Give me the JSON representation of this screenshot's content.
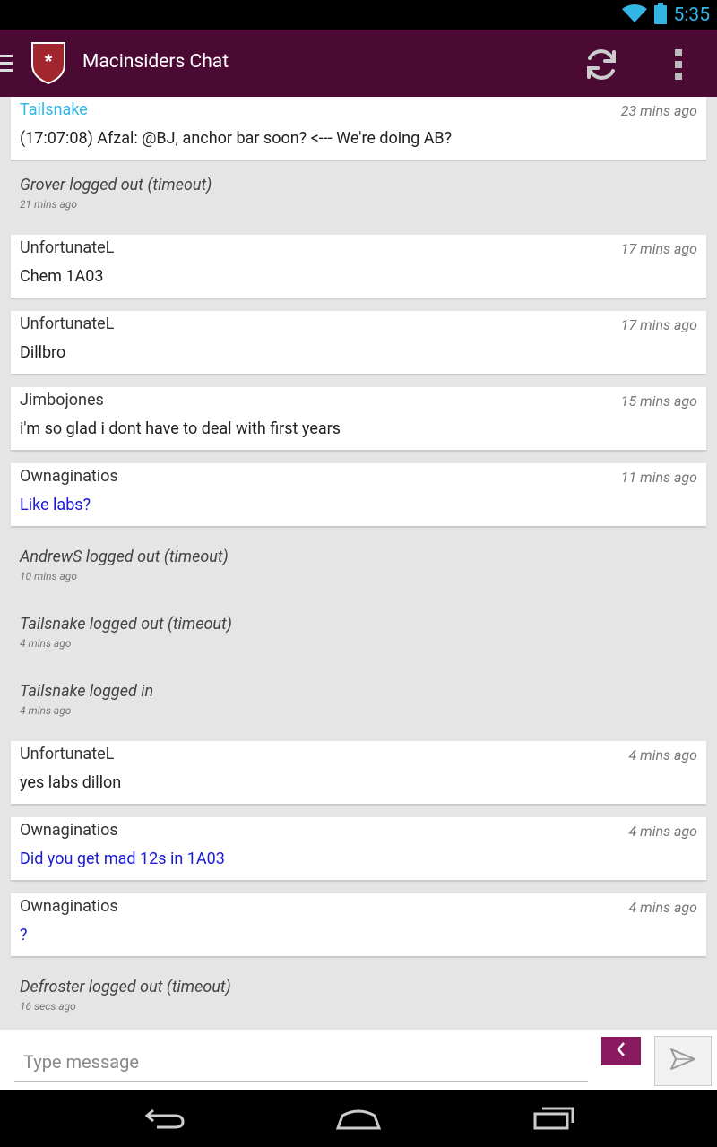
{
  "status_bar": {
    "time": "5:35"
  },
  "action_bar": {
    "title": "Macinsiders Chat"
  },
  "messages": [
    {
      "user": "Tailsnake",
      "time": "23 mins ago",
      "text": "(17:07:08) Afzal: @BJ, anchor bar soon? <--- We're doing AB?"
    },
    {
      "text": "Grover logged out (timeout)",
      "time": "21 mins ago"
    },
    {
      "user": "UnfortunateL",
      "time": "17 mins ago",
      "text": "Chem 1A03"
    },
    {
      "user": "UnfortunateL",
      "time": "17 mins ago",
      "text": "Dillbro"
    },
    {
      "user": "Jimbojones",
      "time": "15 mins ago",
      "text": "i'm so glad i dont have to deal with first years"
    },
    {
      "user": "Ownaginatios",
      "time": "11 mins ago",
      "text": "Like labs?"
    },
    {
      "text": "AndrewS logged out (timeout)",
      "time": "10 mins ago"
    },
    {
      "text": "Tailsnake logged out (timeout)",
      "time": "4 mins ago"
    },
    {
      "text": "Tailsnake logged in",
      "time": "4 mins ago"
    },
    {
      "user": "UnfortunateL",
      "time": "4 mins ago",
      "text": "yes labs dillon"
    },
    {
      "user": "Ownaginatios",
      "time": "4 mins ago",
      "text": "Did you get mad 12s in 1A03"
    },
    {
      "user": "Ownaginatios",
      "time": "4 mins ago",
      "text": "?"
    },
    {
      "text": "Defroster logged out (timeout)",
      "time": "16 secs ago"
    }
  ],
  "input": {
    "placeholder": "Type message"
  },
  "colors": {
    "action_bar": "#4a0a33",
    "accent_cyan": "#33b5e5",
    "own_message_blue": "#1a1ad6",
    "expand_button": "#8a1a5f"
  },
  "icons": {
    "status": [
      "wifi-icon",
      "battery-icon"
    ],
    "action_bar": [
      "menu-icon",
      "app-logo-shield-icon",
      "refresh-icon",
      "overflow-menu-icon"
    ],
    "input": [
      "expand-icon",
      "send-icon"
    ],
    "navigation": [
      "back-icon",
      "home-icon",
      "recent-apps-icon"
    ]
  }
}
